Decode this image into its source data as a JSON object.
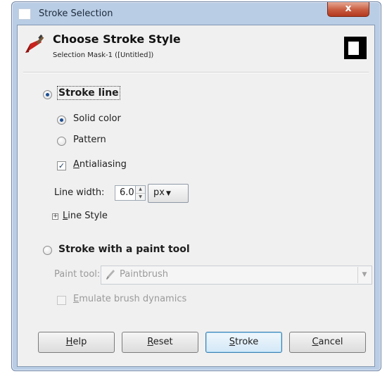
{
  "window": {
    "title": "Stroke Selection",
    "close_label": "x"
  },
  "header": {
    "title": "Choose Stroke Style",
    "subtitle": "Selection Mask-1 ([Untitled])"
  },
  "stroke_line": {
    "label": "Stroke line",
    "selected": true,
    "fill_options": [
      {
        "label": "Solid color",
        "selected": true
      },
      {
        "label": "Pattern",
        "selected": false
      }
    ],
    "antialiasing": {
      "mnemonic": "A",
      "rest": "ntialiasing",
      "checked": true
    },
    "line_width": {
      "label": "Line width:",
      "value": "6.0",
      "unit": "px"
    },
    "line_style": {
      "mnemonic": "L",
      "rest": "ine Style",
      "expander": "+"
    }
  },
  "paint_tool": {
    "label": "Stroke with a paint tool",
    "selected": false,
    "tool_label": "Paint tool:",
    "tool_value": "Paintbrush",
    "emulate": {
      "mnemonic": "E",
      "rest": "mulate brush dynamics",
      "checked": false
    }
  },
  "buttons": {
    "help": {
      "mnemonic": "H",
      "rest": "elp"
    },
    "reset": {
      "mnemonic": "R",
      "rest": "eset"
    },
    "stroke": {
      "mnemonic": "S",
      "rest": "troke"
    },
    "cancel": {
      "mnemonic": "C",
      "rest": "ancel"
    }
  },
  "icons": {
    "header": "paintbrush-stroke-icon",
    "tool": "paintbrush-icon",
    "preview": "stroke-preview-swatch"
  }
}
